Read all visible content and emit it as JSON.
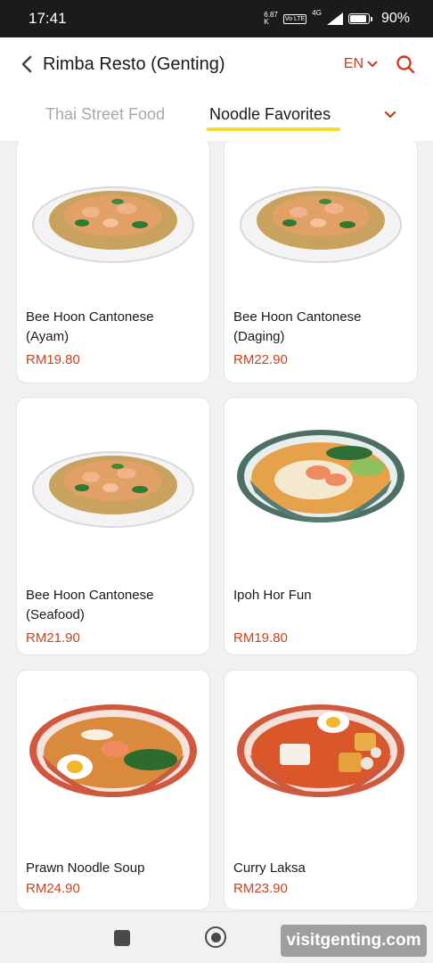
{
  "status_bar": {
    "time": "17:41",
    "data_speed": "6.87",
    "data_unit": "K",
    "volte": "Vo LTE",
    "network": "4G",
    "battery_level": 0.9,
    "battery_text": "90%"
  },
  "header": {
    "title": "Rimba Resto (Genting)",
    "language": "EN"
  },
  "tabs": [
    {
      "label": "Thai Street Food",
      "active": false
    },
    {
      "label": "Noodle Favorites",
      "active": true
    }
  ],
  "products": [
    {
      "name_line1": "Bee Hoon Cantonese",
      "name_line2": "(Ayam)",
      "price": "RM19.80",
      "image": "fried-noodle-plate"
    },
    {
      "name_line1": "Bee Hoon Cantonese",
      "name_line2": "(Daging)",
      "price": "RM22.90",
      "image": "fried-noodle-plate"
    },
    {
      "name_line1": "Bee Hoon Cantonese",
      "name_line2": "(Seafood)",
      "price": "RM21.90",
      "image": "fried-noodle-plate"
    },
    {
      "name_line1": "Ipoh Hor Fun",
      "name_line2": "",
      "price": "RM19.80",
      "image": "hor-fun-bowl"
    },
    {
      "name_line1": "Prawn Noodle Soup",
      "name_line2": "",
      "price": "RM24.90",
      "image": "prawn-noodle-bowl"
    },
    {
      "name_line1": "Curry Laksa",
      "name_line2": "",
      "price": "RM23.90",
      "image": "curry-laksa-bowl"
    }
  ],
  "watermark": "visitgenting.com",
  "colors": {
    "accent": "#cc3a1e",
    "price": "#c8431f",
    "tab_underline": "#f5dc2a"
  }
}
